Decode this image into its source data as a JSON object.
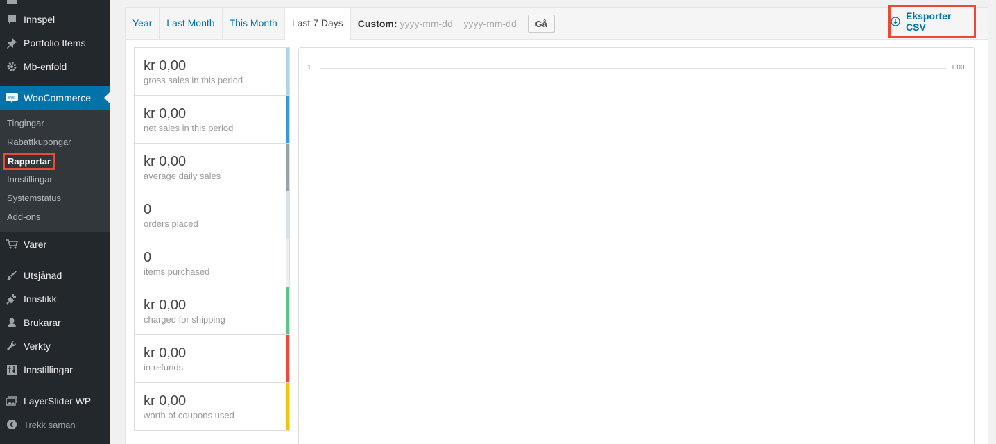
{
  "sidebar": {
    "items": [
      {
        "label": "Innspel",
        "icon": "comment-icon"
      },
      {
        "label": "Portfolio Items",
        "icon": "pin-icon"
      },
      {
        "label": "Mb-enfold",
        "icon": "gear-icon"
      },
      {
        "label": "WooCommerce",
        "icon": "woo-icon"
      },
      {
        "label": "Varer",
        "icon": "cart-icon"
      },
      {
        "label": "Utsjånad",
        "icon": "brush-icon"
      },
      {
        "label": "Innstikk",
        "icon": "plug-icon"
      },
      {
        "label": "Brukarar",
        "icon": "user-icon"
      },
      {
        "label": "Verkty",
        "icon": "wrench-icon"
      },
      {
        "label": "Innstillingar",
        "icon": "settings-icon"
      },
      {
        "label": "LayerSlider WP",
        "icon": "layers-icon"
      }
    ],
    "submenu": [
      "Tingingar",
      "Rabattkupongar",
      "Rapportar",
      "Innstillingar",
      "Systemstatus",
      "Add-ons"
    ],
    "collapse_label": "Trekk saman"
  },
  "tabs": [
    "Year",
    "Last Month",
    "This Month",
    "Last 7 Days"
  ],
  "custom": {
    "label": "Custom:",
    "start_placeholder": "yyyy-mm-dd",
    "end_placeholder": "yyyy-mm-dd",
    "go_label": "Gå"
  },
  "export_label": "Eksporter CSV",
  "legend": [
    {
      "value": "kr 0,00",
      "desc": "gross sales in this period",
      "color": "#b1d4ea"
    },
    {
      "value": "kr 0,00",
      "desc": "net sales in this period",
      "color": "#3498db"
    },
    {
      "value": "kr 0,00",
      "desc": "average daily sales",
      "color": "#95a5a6"
    },
    {
      "value": "0",
      "desc": "orders placed",
      "color": "#dbe1e3"
    },
    {
      "value": "0",
      "desc": "items purchased",
      "color": "#ecf0f1"
    },
    {
      "value": "kr 0,00",
      "desc": "charged for shipping",
      "color": "#5cc488"
    },
    {
      "value": "kr 0,00",
      "desc": "in refunds",
      "color": "#e74c3c"
    },
    {
      "value": "kr 0,00",
      "desc": "worth of coupons used",
      "color": "#f1c40f"
    }
  ],
  "chart": {
    "left_tick": "1",
    "right_tick": "1.00"
  }
}
